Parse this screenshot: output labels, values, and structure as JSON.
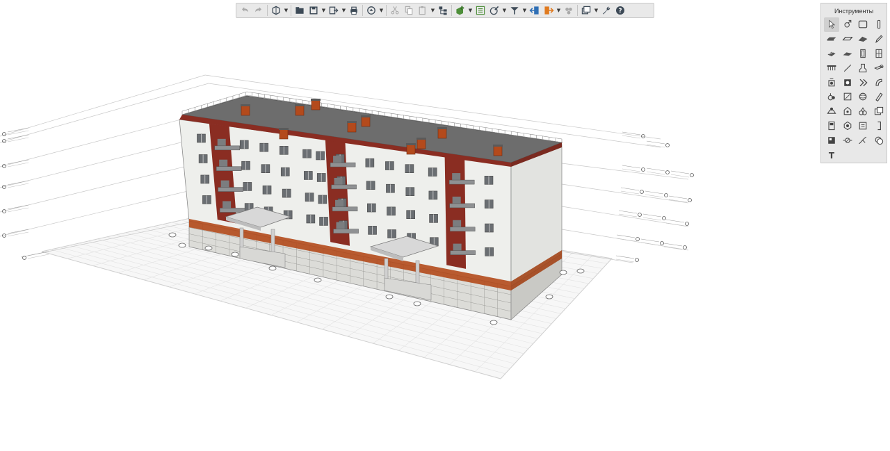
{
  "toolbar": {
    "groups": [
      {
        "items": [
          {
            "icon": "undo-icon",
            "enabled": false
          },
          {
            "icon": "redo-icon",
            "enabled": false
          }
        ]
      },
      {
        "items": [
          {
            "icon": "3d-view-icon",
            "dropdown": true
          }
        ]
      },
      {
        "items": [
          {
            "icon": "open-folder-icon"
          },
          {
            "icon": "save-icon",
            "dropdown": true
          },
          {
            "icon": "export-icon",
            "dropdown": true
          },
          {
            "icon": "print-icon"
          }
        ]
      },
      {
        "items": [
          {
            "icon": "cloud-sync-icon",
            "dropdown": true
          }
        ]
      },
      {
        "items": [
          {
            "icon": "cut-icon",
            "enabled": false
          },
          {
            "icon": "copy-icon",
            "enabled": false
          },
          {
            "icon": "paste-icon",
            "enabled": false,
            "dropdown": true
          },
          {
            "icon": "hierarchy-icon"
          }
        ]
      },
      {
        "items": [
          {
            "icon": "add-object-icon",
            "dropdown": true
          },
          {
            "icon": "list-icon"
          },
          {
            "icon": "edit-icon",
            "dropdown": true
          },
          {
            "icon": "filter-icon",
            "dropdown": true
          },
          {
            "icon": "import-icon"
          },
          {
            "icon": "export-model-icon",
            "dropdown": true
          },
          {
            "icon": "render-icon",
            "enabled": false
          }
        ]
      },
      {
        "items": [
          {
            "icon": "layers-icon",
            "dropdown": true
          },
          {
            "icon": "wrench-icon"
          },
          {
            "icon": "help-icon"
          }
        ]
      }
    ]
  },
  "tools_panel": {
    "title": "Инструменты",
    "selected_index": 0,
    "tools": [
      "pointer-icon",
      "rotate-icon",
      "rectangle-icon",
      "column-icon",
      "slab-icon",
      "floor-icon",
      "roof-icon",
      "pencil-icon",
      "stair-icon",
      "ramp-icon",
      "door-icon",
      "window-icon",
      "beam-icon",
      "line-icon",
      "fixture-icon",
      "pipe-icon",
      "equipment-icon",
      "panel-icon",
      "fitting-icon",
      "duct-icon",
      "valve-icon",
      "box-icon",
      "sphere-icon",
      "cylinder-icon",
      "zone-icon",
      "space-icon",
      "label-icon",
      "section-icon",
      "room-icon",
      "shape-icon",
      "annotation-icon",
      "bracket-icon",
      "grid-icon",
      "measure-icon",
      "curve-icon",
      "cloud-icon",
      "text-icon"
    ]
  },
  "viewport": {
    "colors": {
      "wall": "#ecedeb",
      "brick": "#8a2d22",
      "roof": "#6b6b6b",
      "plinth": "#d9d9d6",
      "grid": "#dcdcdc",
      "trim": "#b34a1c"
    },
    "floors": 4,
    "level_labels_left": 7,
    "level_labels_right": 5
  }
}
